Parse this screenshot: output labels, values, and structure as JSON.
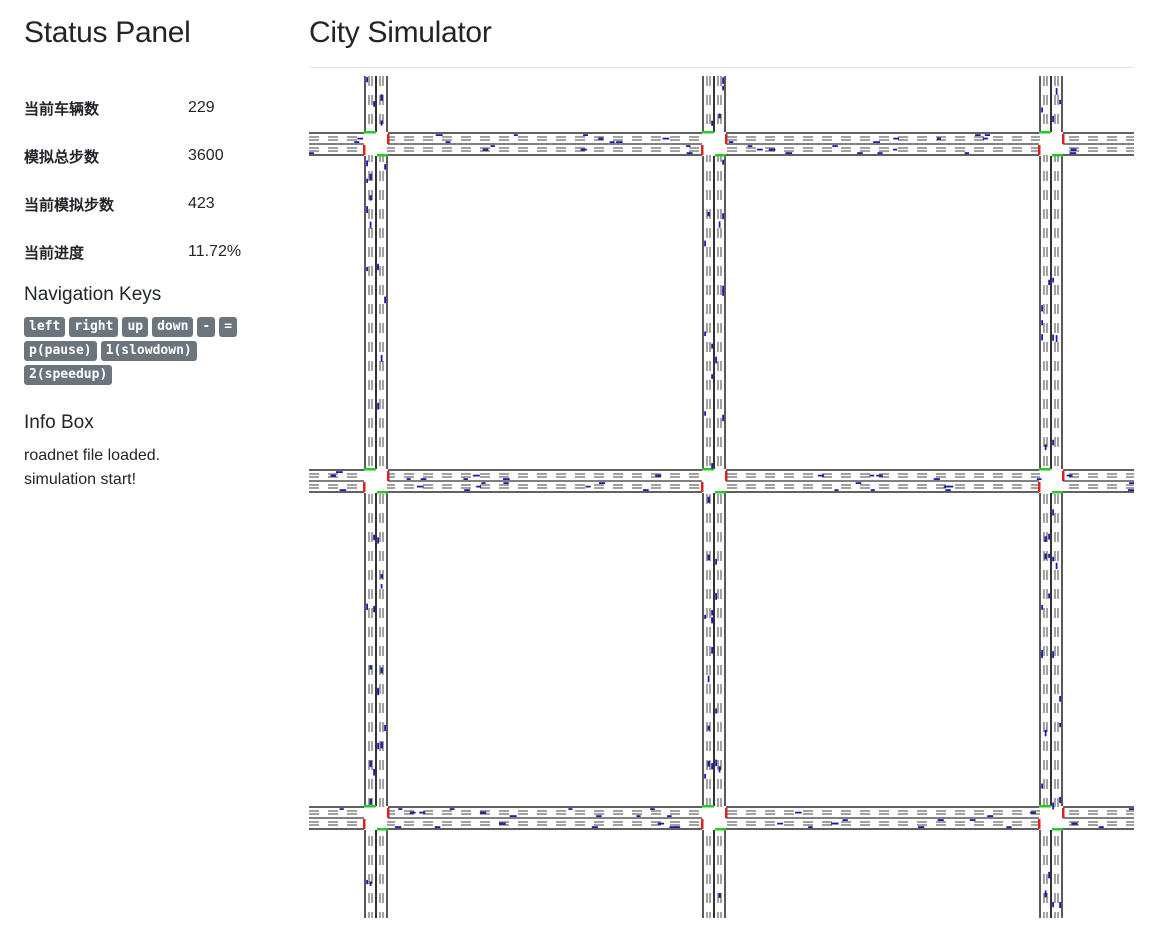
{
  "status_panel": {
    "title": "Status Panel",
    "stats": [
      {
        "label": "当前车辆数",
        "value": "229"
      },
      {
        "label": "模拟总步数",
        "value": "3600"
      },
      {
        "label": "当前模拟步数",
        "value": "423"
      },
      {
        "label": "当前进度",
        "value": "11.72%"
      }
    ]
  },
  "navigation": {
    "title": "Navigation Keys",
    "keys": [
      "left",
      "right",
      "up",
      "down",
      "-",
      "=",
      "p(pause)",
      "1(slowdown)",
      "2(speedup)"
    ]
  },
  "info_box": {
    "title": "Info Box",
    "lines": [
      "roadnet file loaded.",
      "simulation start!"
    ]
  },
  "main": {
    "title": "City Simulator"
  },
  "simulation": {
    "grid_columns": 3,
    "grid_rows": 3,
    "colors": {
      "road_line": "#000000",
      "lane_mark": "#444444",
      "vehicle": "#1c1cb4",
      "signal_green": "#22cc22",
      "signal_red": "#dd2222"
    }
  }
}
